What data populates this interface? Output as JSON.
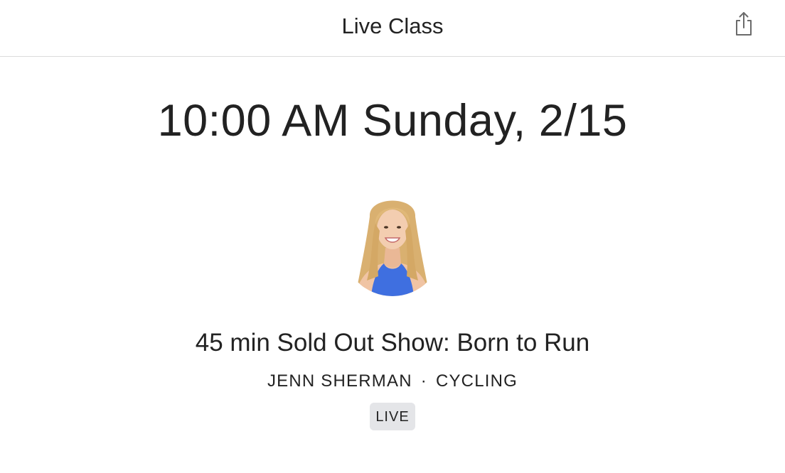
{
  "header": {
    "title": "Live Class",
    "share_icon": "share-icon"
  },
  "schedule": {
    "datetime": "10:00 AM Sunday, 2/15"
  },
  "instructor": {
    "avatar": "instructor-avatar"
  },
  "class": {
    "title": "45 min Sold Out Show: Born to Run",
    "instructor_name": "JENN SHERMAN",
    "separator": "·",
    "discipline": "CYCLING",
    "badge": "LIVE"
  },
  "colors": {
    "text": "#222222",
    "divider": "#dcdcdc",
    "badge_bg": "#e4e5e8",
    "shirt": "#3f6fe0"
  }
}
